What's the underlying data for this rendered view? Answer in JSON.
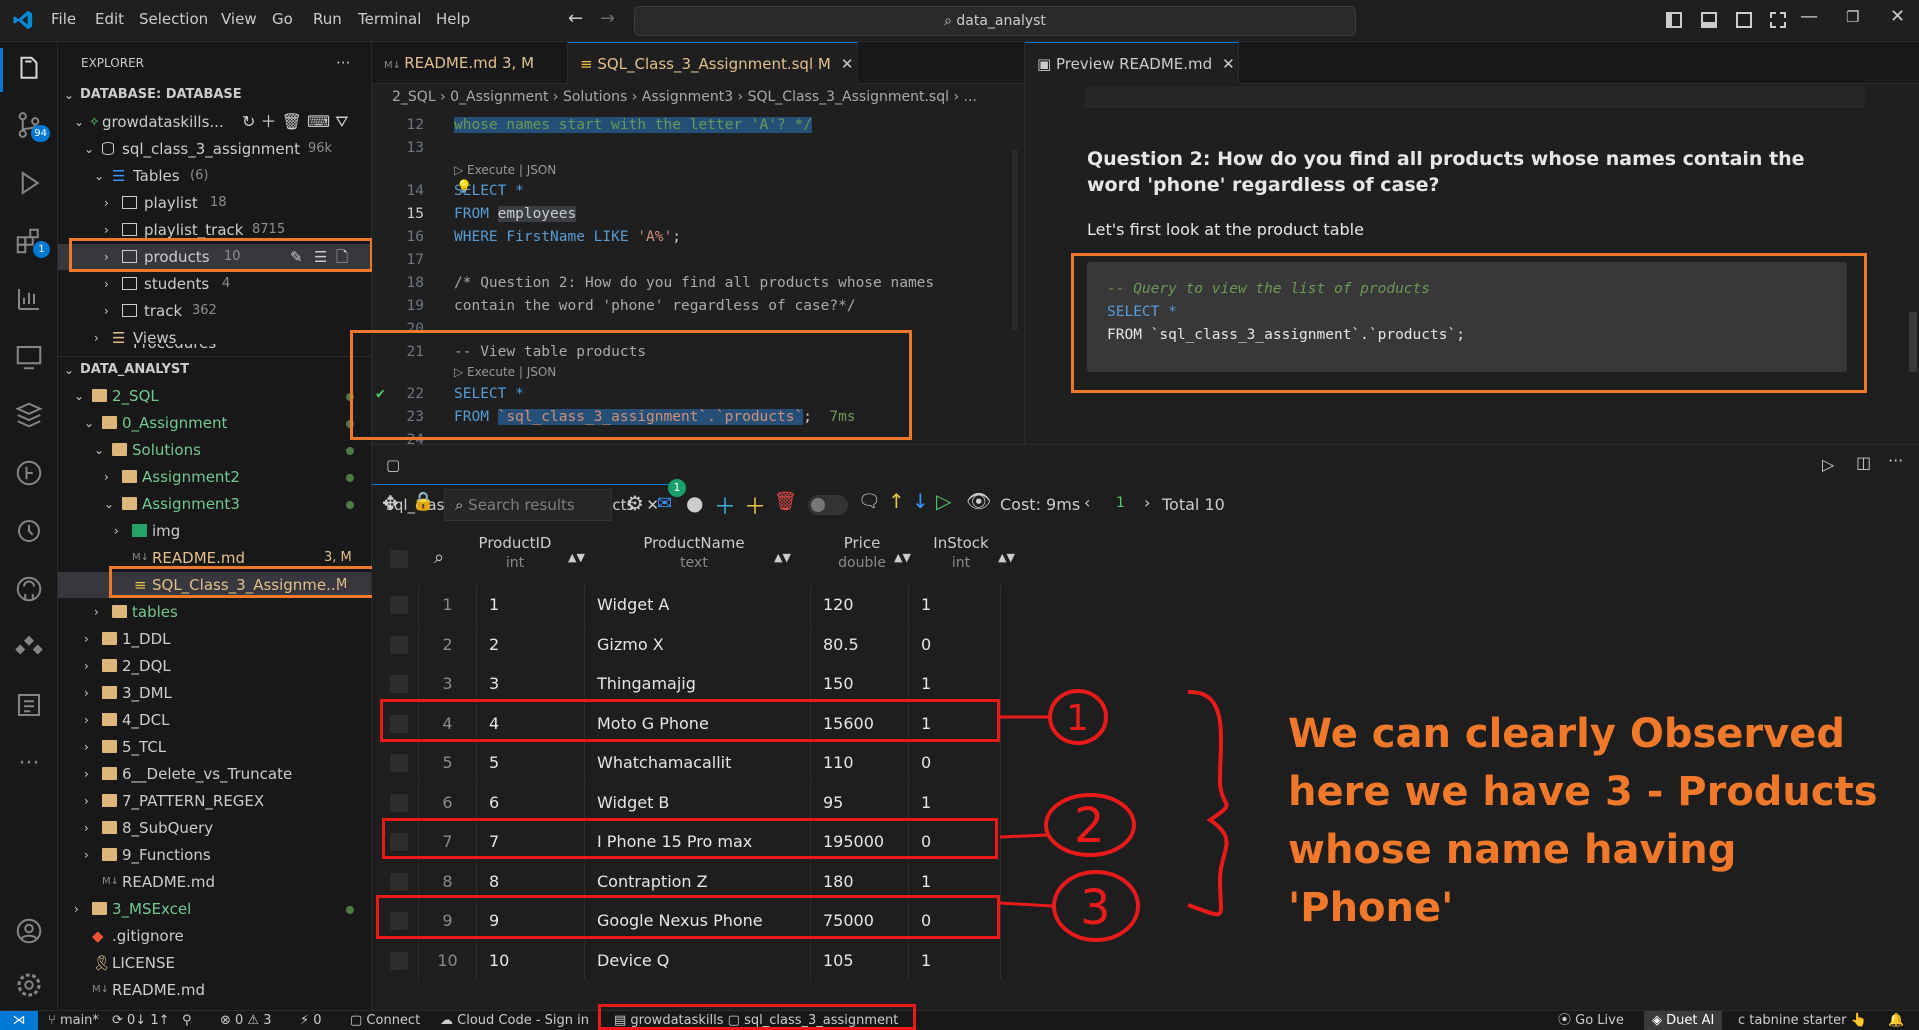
{
  "window": {
    "menu": [
      "File",
      "Edit",
      "Selection",
      "View",
      "Go",
      "Run",
      "Terminal",
      "Help"
    ],
    "search_text": "data_analyst"
  },
  "activity": {
    "source_control_badge": "94",
    "extensions_badge": "1"
  },
  "explorer": {
    "title": "EXPLORER",
    "db_section": "DATABASE: DATABASE",
    "connection": "growdataskills...",
    "schema": "sql_class_3_assignment",
    "schema_size": "96k",
    "tables_label": "Tables",
    "tables_count": "(6)",
    "tables": [
      {
        "name": "playlist",
        "count": "18"
      },
      {
        "name": "playlist_track",
        "count": "8715"
      },
      {
        "name": "products",
        "count": "10"
      },
      {
        "name": "students",
        "count": "4"
      },
      {
        "name": "track",
        "count": "362"
      }
    ],
    "views_label": "Views",
    "cut_label": "Procedures",
    "folder_section": "DATA_ANALYST",
    "folders": {
      "f2sql": "2_SQL",
      "assignment": "0_Assignment",
      "solutions": "Solutions",
      "a2": "Assignment2",
      "a3": "Assignment3",
      "img": "img",
      "readme": "README.md",
      "readme_status": "3, M",
      "sqlfile": "SQL_Class_3_Assignme...",
      "sqlfile_status": "M",
      "tables": "tables",
      "ddl": "1_DDL",
      "dql": "2_DQL",
      "dml": "3_DML",
      "dcl": "4_DCL",
      "tcl": "5_TCL",
      "del": "6__Delete_vs_Truncate",
      "regex": "7_PATTERN_REGEX",
      "subq": "8_SubQuery",
      "func": "9_Functions",
      "readme2": "README.md",
      "msexcel": "3_MSExcel",
      "gitignore": ".gitignore",
      "license": "LICENSE",
      "readme3": "README.md"
    }
  },
  "editor": {
    "tab1": "README.md",
    "tab1_status": "3, M",
    "tab2": "SQL_Class_3_Assignment.sql",
    "tab2_status": "M",
    "breadcrumb": "2_SQL › 0_Assignment › Solutions › Assignment3 › SQL_Class_3_Assignment.sql › ...",
    "line_numbers": [
      "12",
      "13",
      "14",
      "15",
      "16",
      "17",
      "18",
      "19",
      "20",
      "21",
      "22",
      "23",
      "24"
    ],
    "lines": {
      "l12": "whose names start with the letter 'A'? */",
      "codelens": "Execute | JSON",
      "l14": "SELECT *",
      "l15a": "FROM ",
      "l15b": "employees",
      "l16a": "WHERE FirstName LIKE ",
      "l16b": "'A%'",
      "l16c": ";",
      "l18": "/* Question 2: How do you find all products whose names",
      "l19": "contain the word 'phone' regardless of case?*/",
      "l21": "-- View table products",
      "l22": "SELECT *",
      "l23a": "FROM ",
      "l23b": "`sql_class_3_assignment`.`products`",
      "l23c": ";",
      "l23t": "7ms"
    }
  },
  "preview": {
    "tab": "Preview README.md",
    "heading": "Question 2: How do you find all products whose names contain the word 'phone' regardless of case?",
    "para": "Let's first look at the product table",
    "code": [
      "-- Query to view the list of products",
      "SELECT *",
      "FROM `sql_class_3_assignment`.`products`;"
    ]
  },
  "results": {
    "tab": "sql_class_3_assignment.products",
    "search_placeholder": "Search results",
    "notif_badge": "1",
    "cost": "Cost: 9ms",
    "page": "1",
    "total": "Total 10",
    "columns": [
      {
        "name": "ProductID",
        "type": "int"
      },
      {
        "name": "ProductName",
        "type": "text"
      },
      {
        "name": "Price",
        "type": "double"
      },
      {
        "name": "InStock",
        "type": "int"
      }
    ],
    "rows": [
      [
        "1",
        "1",
        "Widget A",
        "120",
        "1"
      ],
      [
        "2",
        "2",
        "Gizmo X",
        "80.5",
        "0"
      ],
      [
        "3",
        "3",
        "Thingamajig",
        "150",
        "1"
      ],
      [
        "4",
        "4",
        "Moto G Phone",
        "15600",
        "1"
      ],
      [
        "5",
        "5",
        "Whatchamacallit",
        "110",
        "0"
      ],
      [
        "6",
        "6",
        "Widget B",
        "95",
        "1"
      ],
      [
        "7",
        "7",
        "I Phone 15 Pro max",
        "195000",
        "0"
      ],
      [
        "8",
        "8",
        "Contraption Z",
        "180",
        "1"
      ],
      [
        "9",
        "9",
        "Google Nexus Phone",
        "75000",
        "0"
      ],
      [
        "10",
        "10",
        "Device Q",
        "105",
        "1"
      ]
    ]
  },
  "annotation": {
    "lines": [
      "We can clearly Observed",
      "here we have 3 - Products",
      "whose name having 'Phone'"
    ],
    "marks": [
      "1",
      "2",
      "3"
    ]
  },
  "status": {
    "branch": "main*",
    "sync": "0↓ 1↑",
    "problems": "⊗ 0 ⚠ 3",
    "ports": "0",
    "connect": "Connect",
    "cloud": "Cloud Code - Sign in",
    "db": "growdataskills",
    "schema": "sql_class_3_assignment",
    "golive": "Go Live",
    "duet": "Duet AI",
    "tabnine": "tabnine starter"
  },
  "colors": {
    "accent": "#0078d4",
    "annotation_orange": "#f0782a",
    "annotation_red": "#e81a1a",
    "folder": "#dcb67a"
  }
}
